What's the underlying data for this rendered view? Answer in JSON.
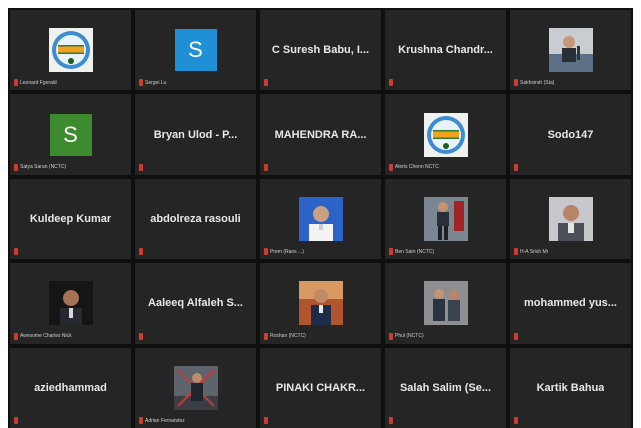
{
  "tiles": [
    {
      "kind": "photo",
      "avatar": "emblem",
      "caption": "Leonard Fgerald"
    },
    {
      "kind": "letter",
      "letter": "S",
      "color": "#1f8fd6",
      "caption": "Sergei Lu"
    },
    {
      "kind": "name",
      "name": "C Suresh Babu, I...",
      "caption": ""
    },
    {
      "kind": "name",
      "name": "Krushna Chandr...",
      "caption": ""
    },
    {
      "kind": "photo",
      "avatar": "speaker",
      "caption": "Sakhsindr (Sta)"
    },
    {
      "kind": "letter",
      "letter": "S",
      "color": "#3e8a2e",
      "caption": "Satya Saran (NCTC)"
    },
    {
      "kind": "name",
      "name": "Bryan Ulod - P...",
      "caption": ""
    },
    {
      "kind": "name",
      "name": "MAHENDRA RA...",
      "caption": ""
    },
    {
      "kind": "photo",
      "avatar": "emblem",
      "caption": "Aloris Chenn NCTC"
    },
    {
      "kind": "name",
      "name": "Sodo147",
      "caption": ""
    },
    {
      "kind": "name",
      "name": "Kuldeep Kumar",
      "caption": ""
    },
    {
      "kind": "name",
      "name": "abdolreza rasouli",
      "caption": ""
    },
    {
      "kind": "photo",
      "avatar": "portrait-blue",
      "caption": "Prem (Rans ...)"
    },
    {
      "kind": "photo",
      "avatar": "standing",
      "caption": "Ben Sam (NCTC)"
    },
    {
      "kind": "photo",
      "avatar": "suit-grey",
      "caption": "H-A Srish Mr"
    },
    {
      "kind": "photo",
      "avatar": "dark-portrait",
      "caption": "Awesome Charles Nick"
    },
    {
      "kind": "name",
      "name": "Aaleeq Alfaleh S...",
      "caption": ""
    },
    {
      "kind": "photo",
      "avatar": "uniform",
      "caption": "Roshan (NCTC)"
    },
    {
      "kind": "photo",
      "avatar": "group",
      "caption": "Phul (NCTC)"
    },
    {
      "kind": "name",
      "name": "mohammed yus...",
      "caption": ""
    },
    {
      "kind": "name",
      "name": "aziedhammad",
      "caption": ""
    },
    {
      "kind": "photo",
      "avatar": "pose",
      "caption": "Adrian Fernandez"
    },
    {
      "kind": "name",
      "name": "PINAKI CHAKR...",
      "caption": ""
    },
    {
      "kind": "name",
      "name": "Salah Salim (Se...",
      "caption": ""
    },
    {
      "kind": "name",
      "name": "Kartik Bahua",
      "caption": ""
    }
  ]
}
